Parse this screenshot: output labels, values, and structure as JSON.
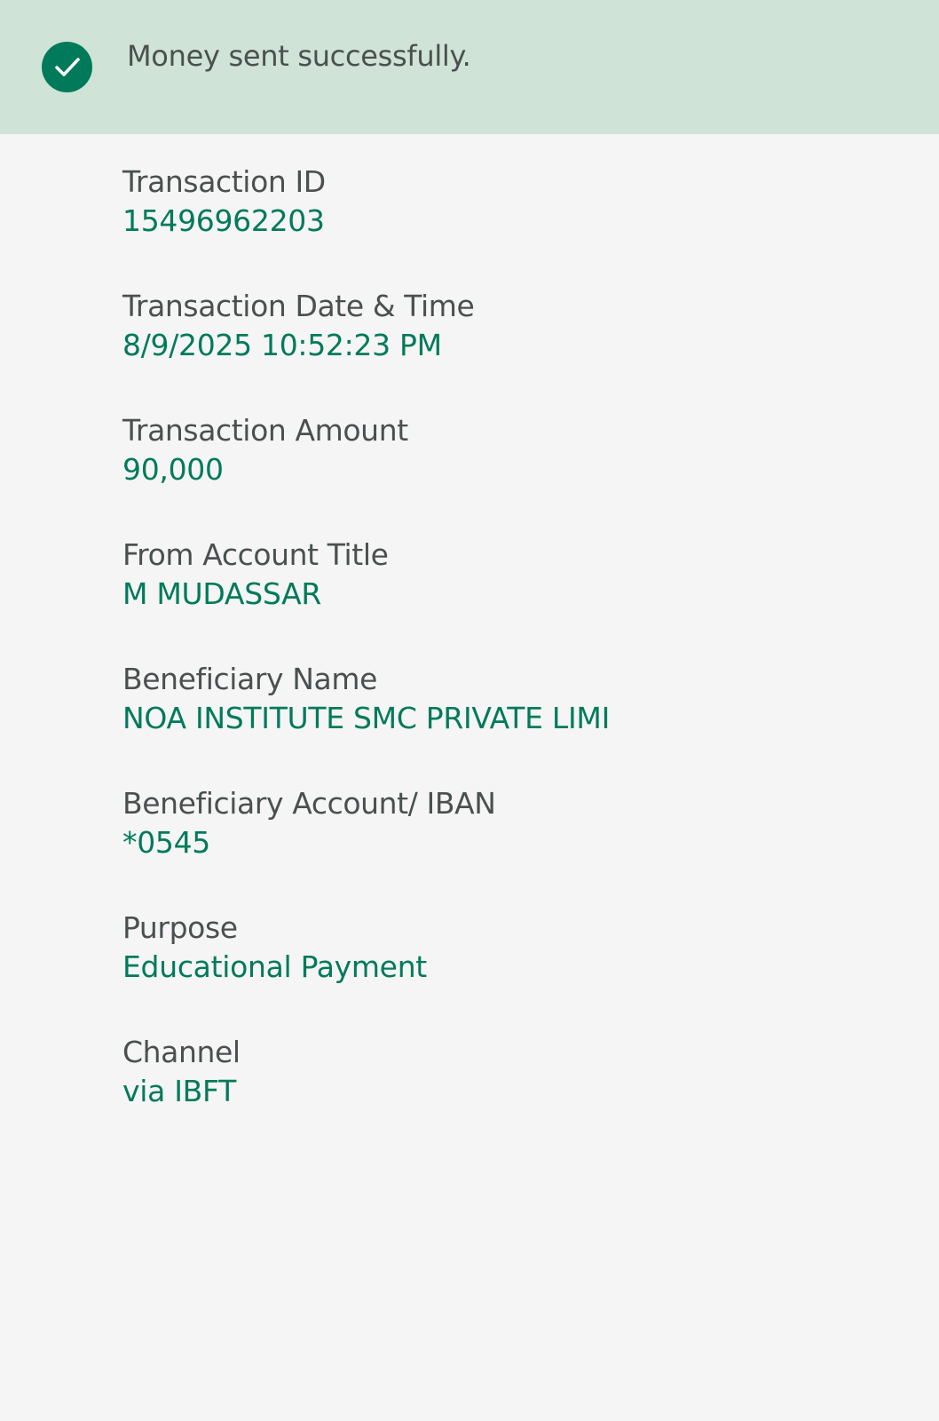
{
  "banner": {
    "icon": "check-circle-icon",
    "message": "Money sent successfully.",
    "background_color": "#cfe3d6",
    "icon_color": "#007a5a"
  },
  "colors": {
    "label": "#4a5050",
    "value": "#007a5a",
    "page_background": "#f5f5f5"
  },
  "details": [
    {
      "label": "Transaction ID",
      "value": "15496962203"
    },
    {
      "label": "Transaction Date & Time",
      "value": "8/9/2025 10:52:23 PM"
    },
    {
      "label": "Transaction Amount",
      "value": "90,000"
    },
    {
      "label": "From Account Title",
      "value": "M MUDASSAR"
    },
    {
      "label": "Beneficiary Name",
      "value": "NOA INSTITUTE SMC PRIVATE LIMI"
    },
    {
      "label": "Beneficiary Account/ IBAN",
      "value": "*0545"
    },
    {
      "label": "Purpose",
      "value": "Educational Payment"
    },
    {
      "label": "Channel",
      "value": "via IBFT"
    }
  ]
}
